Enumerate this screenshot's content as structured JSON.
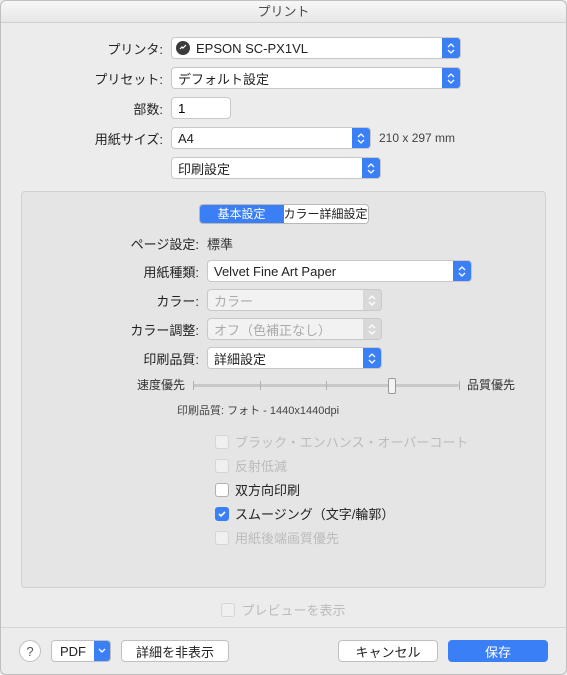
{
  "title": "プリント",
  "labels": {
    "printer": "プリンタ:",
    "preset": "プリセット:",
    "copies": "部数:",
    "papersize": "用紙サイズ:",
    "section": "印刷設定",
    "page_setup": "ページ設定:",
    "media_type": "用紙種類:",
    "color": "カラー:",
    "color_adjust": "カラー調整:",
    "print_quality": "印刷品質:",
    "speed_priority": "速度優先",
    "quality_priority": "品質優先",
    "quality_note_label": "印刷品質:"
  },
  "printer": {
    "value": "EPSON SC-PX1VL"
  },
  "preset": {
    "value": "デフォルト設定"
  },
  "copies": {
    "value": "1"
  },
  "papersize": {
    "value": "A4",
    "dimensions": "210 x 297 mm"
  },
  "tabs": {
    "basic": "基本設定",
    "advanced": "カラー詳細設定"
  },
  "page_setup_value": "標準",
  "media_type_value": "Velvet Fine Art Paper",
  "color_value": "カラー",
  "color_adjust_value": "オフ（色補正なし）",
  "print_quality_value": "詳細設定",
  "quality_note_value": "フォト - 1440x1440dpi",
  "checks": {
    "black_enhance": "ブラック・エンハンス・オーバーコート",
    "reflect_reduce": "反射低減",
    "bidirectional": "双方向印刷",
    "smoothing": "スムージング（文字/輪郭）",
    "trailing_edge": "用紙後端画質優先"
  },
  "preview_label": "プレビューを表示",
  "footer": {
    "pdf": "PDF",
    "details": "詳細を非表示",
    "cancel": "キャンセル",
    "save": "保存"
  }
}
